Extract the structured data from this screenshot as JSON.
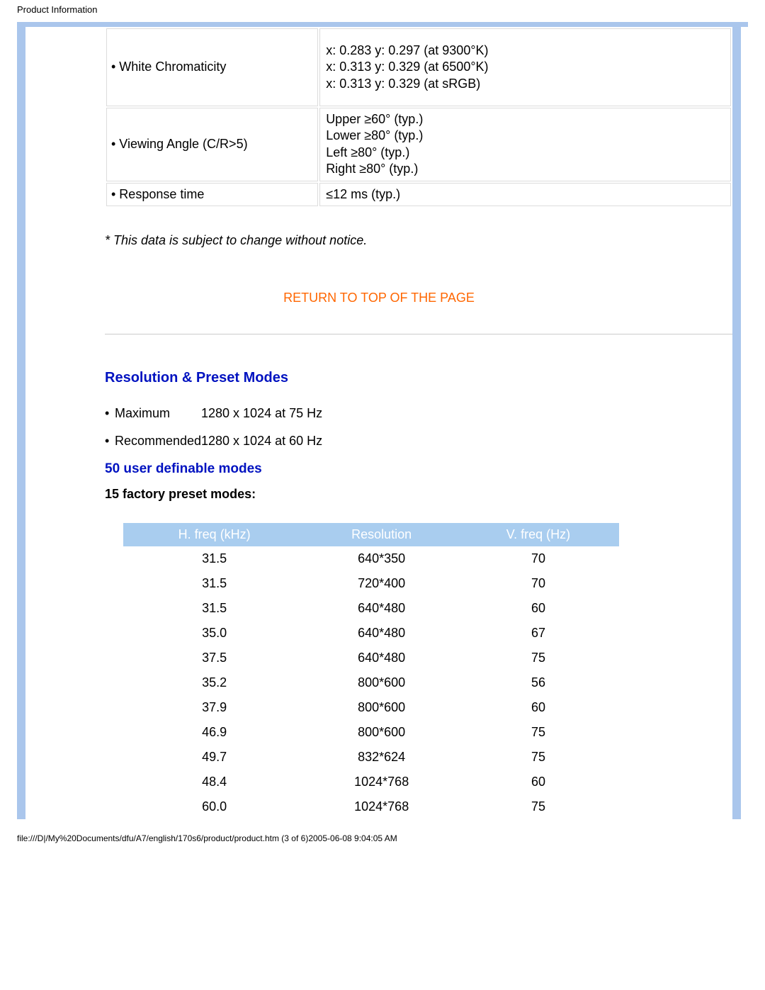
{
  "page_title": "Product Information",
  "spec_table": {
    "rows": [
      {
        "label": "• White Chromaticity",
        "value": "x: 0.283 y: 0.297 (at 9300°K)\nx: 0.313 y: 0.329 (at 6500°K)\nx: 0.313 y: 0.329 (at sRGB)",
        "cls": "tall"
      },
      {
        "label": "• Viewing Angle (C/R>5)",
        "value": "Upper ≥60° (typ.)\nLower ≥80° (typ.)\nLeft ≥80° (typ.)\nRight ≥80° (typ.)",
        "cls": "med"
      },
      {
        "label": "• Response time",
        "value": "≤12 ms (typ.)",
        "cls": ""
      }
    ]
  },
  "notice": "* This data is subject to change without notice.",
  "return_link": "RETURN TO TOP OF THE PAGE",
  "resolution": {
    "heading": "Resolution & Preset Modes",
    "items": [
      {
        "bullet": "•",
        "k": "Maximum",
        "v": "1280 x 1024 at 75 Hz"
      },
      {
        "bullet": "•",
        "k": "Recommended",
        "v": "1280 x 1024 at 60 Hz"
      }
    ],
    "user_modes": "50 user definable modes",
    "factory_heading": "15 factory preset modes:"
  },
  "modes_table": {
    "headers": [
      "H. freq (kHz)",
      "Resolution",
      "V. freq (Hz)"
    ],
    "rows": [
      [
        "31.5",
        "640*350",
        "70"
      ],
      [
        "31.5",
        "720*400",
        "70"
      ],
      [
        "31.5",
        "640*480",
        "60"
      ],
      [
        "35.0",
        "640*480",
        "67"
      ],
      [
        "37.5",
        "640*480",
        "75"
      ],
      [
        "35.2",
        "800*600",
        "56"
      ],
      [
        "37.9",
        "800*600",
        "60"
      ],
      [
        "46.9",
        "800*600",
        "75"
      ],
      [
        "49.7",
        "832*624",
        "75"
      ],
      [
        "48.4",
        "1024*768",
        "60"
      ],
      [
        "60.0",
        "1024*768",
        "75"
      ]
    ]
  },
  "footer": "file:///D|/My%20Documents/dfu/A7/english/170s6/product/product.htm (3 of 6)2005-06-08 9:04:05 AM"
}
